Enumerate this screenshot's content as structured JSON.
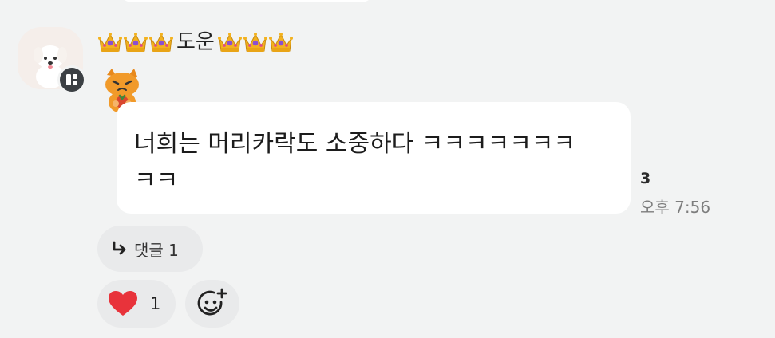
{
  "message": {
    "sender": {
      "name": "도운",
      "avatar_icon": "white-puppy-avatar",
      "badge_icon": "channel-badge-icon",
      "decoration_icon": "crown-emoji",
      "crowns_before": 3,
      "crowns_after": 3
    },
    "sticker_icon": "orange-cat-sticker",
    "text": "너희는 머리카락도 소중하다 ㅋㅋㅋㅋㅋㅋㅋ\nㅋㅋ",
    "unread_count": "3",
    "time": "오후 7:56"
  },
  "replies": {
    "icon": "reply-arrow-icon",
    "label": "댓글 1"
  },
  "reactions": [
    {
      "icon": "heart-icon",
      "count": "1",
      "color": "#e8333b"
    }
  ],
  "add_reaction": {
    "icon": "add-emoji-icon"
  },
  "colors": {
    "background": "#f2f3f3",
    "bubble": "#ffffff",
    "chip": "#e9eaeb",
    "timestamp": "#7d7d7d"
  }
}
